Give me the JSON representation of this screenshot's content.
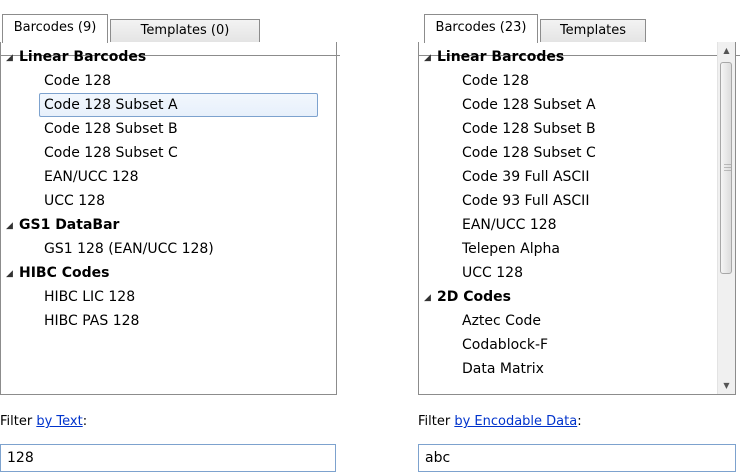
{
  "left": {
    "tabs": [
      "Barcodes (9)",
      "Templates (0)"
    ],
    "tree": [
      {
        "type": "group",
        "label": "Linear Barcodes"
      },
      {
        "type": "item",
        "label": "Code 128"
      },
      {
        "type": "item",
        "label": "Code 128 Subset A",
        "selected": true
      },
      {
        "type": "item",
        "label": "Code 128 Subset B"
      },
      {
        "type": "item",
        "label": "Code 128 Subset C"
      },
      {
        "type": "item",
        "label": "EAN/UCC 128"
      },
      {
        "type": "item",
        "label": "UCC 128"
      },
      {
        "type": "group",
        "label": "GS1 DataBar"
      },
      {
        "type": "item",
        "label": "GS1 128 (EAN/UCC 128)"
      },
      {
        "type": "group",
        "label": "HIBC Codes"
      },
      {
        "type": "item",
        "label": "HIBC LIC 128"
      },
      {
        "type": "item",
        "label": "HIBC PAS 128"
      }
    ],
    "filter_prefix": "Filter ",
    "filter_link": "by Text",
    "filter_suffix": ":",
    "filter_value": "128"
  },
  "right": {
    "tabs": [
      "Barcodes (23)",
      "Templates"
    ],
    "tree": [
      {
        "type": "group",
        "label": "Linear Barcodes"
      },
      {
        "type": "item",
        "label": "Code 128"
      },
      {
        "type": "item",
        "label": "Code 128 Subset A"
      },
      {
        "type": "item",
        "label": "Code 128 Subset B"
      },
      {
        "type": "item",
        "label": "Code 128 Subset C"
      },
      {
        "type": "item",
        "label": "Code 39 Full ASCII"
      },
      {
        "type": "item",
        "label": "Code 93 Full ASCII"
      },
      {
        "type": "item",
        "label": "EAN/UCC 128"
      },
      {
        "type": "item",
        "label": "Telepen Alpha"
      },
      {
        "type": "item",
        "label": "UCC 128"
      },
      {
        "type": "group",
        "label": "2D Codes"
      },
      {
        "type": "item",
        "label": "Aztec Code"
      },
      {
        "type": "item",
        "label": "Codablock-F"
      },
      {
        "type": "item",
        "label": "Data Matrix"
      }
    ],
    "filter_prefix": "Filter ",
    "filter_link": "by Encodable Data",
    "filter_suffix": ":",
    "filter_value": "abc"
  }
}
